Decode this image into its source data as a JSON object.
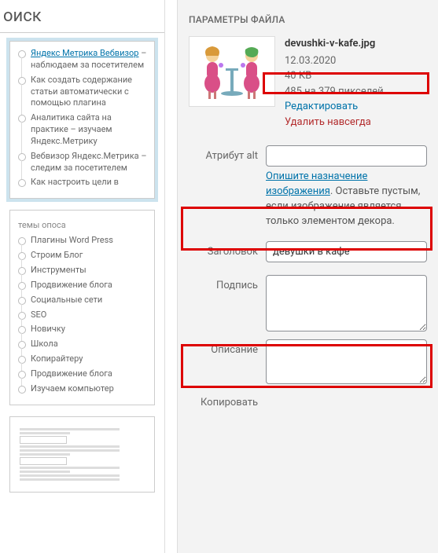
{
  "leftPanel": {
    "searchLabel": "оиск",
    "thumb1_items": [
      {
        "html": "<a href='#'>Яндекс Метрика Вебвизор</a> – наблюдаем за посетителем"
      },
      {
        "html": "Как создать содержание статьи автоматически с помощью плагина"
      },
      {
        "html": "Аналитика сайта на практике – изучаем Яндекс.Метрику"
      },
      {
        "html": "Вебвизор Яндекс.Метрика – следим за посетителем"
      },
      {
        "html": "Как настроить цели в"
      }
    ],
    "thumb2_header": "темы опоса",
    "thumb2_items": [
      "Плагины Word Press",
      "Строим Блог",
      "Инструменты",
      "Продвижение блога",
      "Социальные сети",
      "SEO",
      "Новичку",
      "Школа",
      "Копирайтеру",
      "Продвижение блога",
      "Изучаем компьютер"
    ]
  },
  "panel": {
    "title": "ПАРАМЕТРЫ ФАЙЛА",
    "file": {
      "name": "devushki-v-kafe.jpg",
      "date": "12.03.2020",
      "size": "40 КВ",
      "dims": "485 на 379 пикселей",
      "editLabel": "Редактировать",
      "deleteLabel": "Удалить навсегда"
    },
    "fields": {
      "altLabel": "Атрибут alt",
      "altValue": "",
      "altHelpLink": "Опишите назначение изображения",
      "altHelpRest": ". Оставьте пустым, если изображение является только элементом декора.",
      "titleLabel": "Заголовок",
      "titleValue": "девушки в кафе",
      "captionLabel": "Подпись",
      "captionValue": "",
      "descLabel": "Описание",
      "descValue": "",
      "copyLabel": "Копировать"
    }
  }
}
